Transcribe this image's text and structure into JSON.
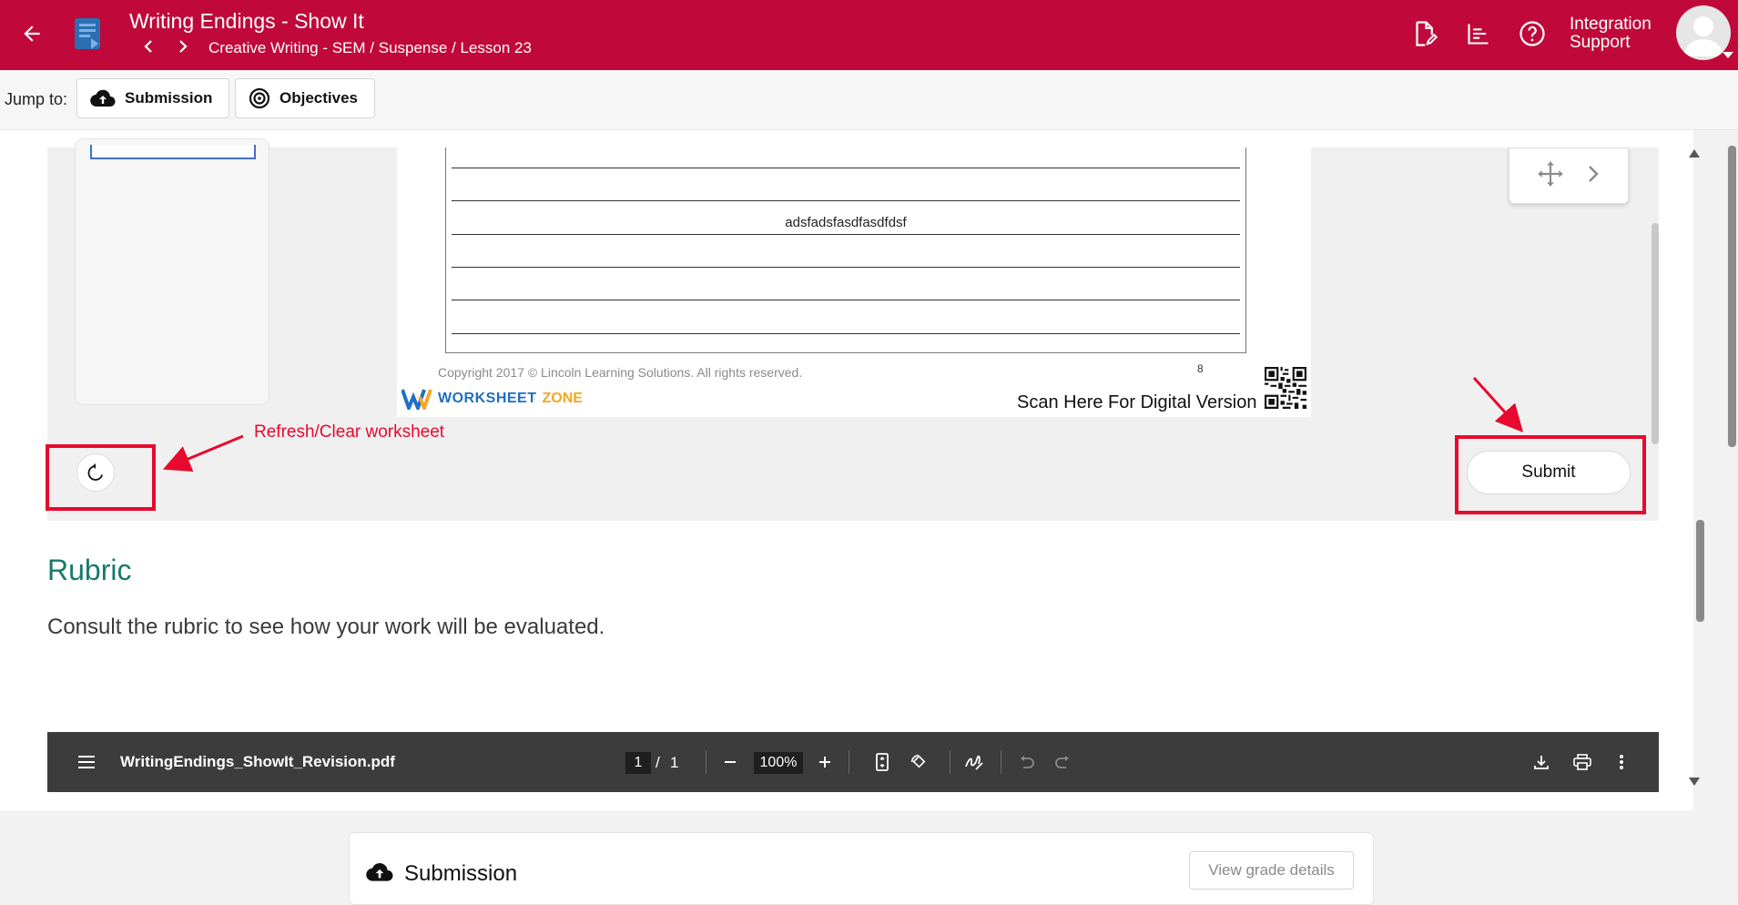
{
  "header": {
    "title": "Writing Endings - Show It",
    "breadcrumb": "Creative Writing - SEM / Suspense / Lesson 23",
    "user_name_line1": "Integration",
    "user_name_line2": "Support",
    "icons": [
      "back-arrow-icon",
      "lesson-book-icon",
      "chevron-left-icon",
      "chevron-right-icon",
      "edit-document-icon",
      "gradebook-icon",
      "help-icon",
      "avatar"
    ]
  },
  "jump": {
    "label": "Jump to:",
    "submission_label": "Submission",
    "objectives_label": "Objectives"
  },
  "worksheet": {
    "written_text": "adsfadsfasdfasdfdsf",
    "copyright": "Copyright 2017 © Lincoln Learning Solutions. All rights reserved.",
    "page_number": "8",
    "logo_part1": "WORKSHEET",
    "logo_part2": "ZONE",
    "scan_text": "Scan Here For Digital Version"
  },
  "actions": {
    "submit_label": "Submit",
    "annotation": "Refresh/Clear worksheet",
    "annotation_color": "#e8092e"
  },
  "rubric": {
    "title": "Rubric",
    "description": "Consult the rubric to see how your work will be evaluated."
  },
  "pdf_toolbar": {
    "filename": "WritingEndings_ShowIt_Revision.pdf",
    "current_page": "1",
    "separator": "/",
    "total_pages": "1",
    "zoom": "100%"
  },
  "submission": {
    "title": "Submission",
    "grade_button": "View grade details"
  },
  "colors": {
    "brand": "#c0093a",
    "rubric_title": "#177a6a",
    "pdf_toolbar": "#3c3c3c"
  }
}
